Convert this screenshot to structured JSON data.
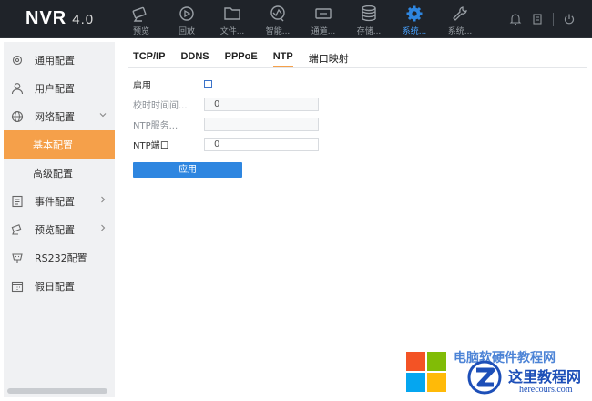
{
  "app": {
    "name": "NVR",
    "version": "4.0"
  },
  "nav": [
    {
      "icon": "camera-icon",
      "label": "预览"
    },
    {
      "icon": "playback-icon",
      "label": "回放"
    },
    {
      "icon": "folder-icon",
      "label": "文件..."
    },
    {
      "icon": "smart-analysis-icon",
      "label": "智能..."
    },
    {
      "icon": "channel-icon",
      "label": "通道..."
    },
    {
      "icon": "storage-icon",
      "label": "存储..."
    },
    {
      "icon": "gear-icon",
      "label": "系统...",
      "active": true
    },
    {
      "icon": "wrench-icon",
      "label": "系统..."
    }
  ],
  "sidebar": {
    "items": [
      {
        "label": "通用配置",
        "icon": "settings-icon"
      },
      {
        "label": "用户配置",
        "icon": "user-icon"
      },
      {
        "label": "网络配置",
        "icon": "globe-icon",
        "expanded": true
      },
      {
        "label": "基本配置",
        "sub": true,
        "active": true
      },
      {
        "label": "高级配置",
        "sub": true
      },
      {
        "label": "事件配置",
        "icon": "event-icon",
        "has_children": true
      },
      {
        "label": "预览配置",
        "icon": "preview-camera-icon",
        "has_children": true
      },
      {
        "label": "RS232配置",
        "icon": "rs232-icon"
      },
      {
        "label": "假日配置",
        "icon": "calendar-icon"
      }
    ]
  },
  "tabs": [
    {
      "label": "TCP/IP"
    },
    {
      "label": "DDNS"
    },
    {
      "label": "PPPoE"
    },
    {
      "label": "NTP",
      "active": true
    },
    {
      "label": "端口映射"
    }
  ],
  "form": {
    "enable": {
      "label": "启用",
      "checked": false
    },
    "interval": {
      "label": "校时时间间...",
      "value": "0"
    },
    "server": {
      "label": "NTP服务...",
      "value": ""
    },
    "port": {
      "label": "NTP端口",
      "value": "0"
    },
    "apply_label": "应用"
  },
  "watermark": {
    "blue_text": "电脑软硬件教程网",
    "title": "这里教程网",
    "url": "herecours.com"
  },
  "colors": {
    "topbar": "#1f2329",
    "accent_orange": "#f5a04a",
    "accent_blue": "#2e86e0",
    "sidebar_bg": "#f0f1f3"
  }
}
